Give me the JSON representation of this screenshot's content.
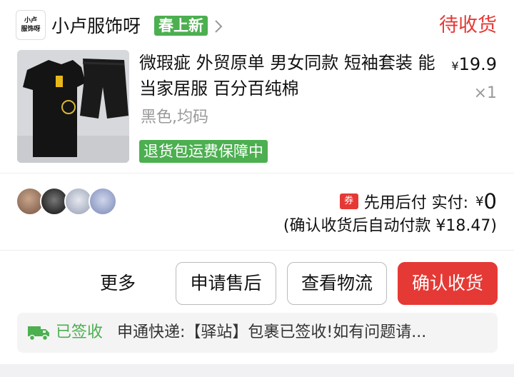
{
  "shop": {
    "logo_line1": "小卢",
    "logo_line2": "服饰呀",
    "name": "小卢服饰呀",
    "tag": "春上新"
  },
  "order": {
    "status": "待收货"
  },
  "product": {
    "title": "微瑕疵 外贸原单 男女同款 短袖套装 能当家居服 百分百纯棉",
    "spec": "黑色,均码",
    "guarantee": "退货包运费保障中",
    "price_currency": "¥",
    "price_value": "19.9",
    "quantity": "×1"
  },
  "payment": {
    "coupon_badge": "券",
    "label": "先用后付 实付:",
    "paid_currency": "¥",
    "paid_amount": "0",
    "auto_pay_note": "(确认收货后自动付款 ¥18.47)"
  },
  "actions": {
    "more": "更多",
    "after_sales": "申请售后",
    "view_logistics": "查看物流",
    "confirm_receipt": "确认收货"
  },
  "logistics": {
    "status": "已签收",
    "message": "申通快递:【驿站】包裹已签收!如有问题请..."
  },
  "colors": {
    "accent_red": "#e53935",
    "accent_green": "#4caf50"
  },
  "icons": [
    "chevron-right-icon",
    "truck-icon",
    "coupon-icon"
  ]
}
